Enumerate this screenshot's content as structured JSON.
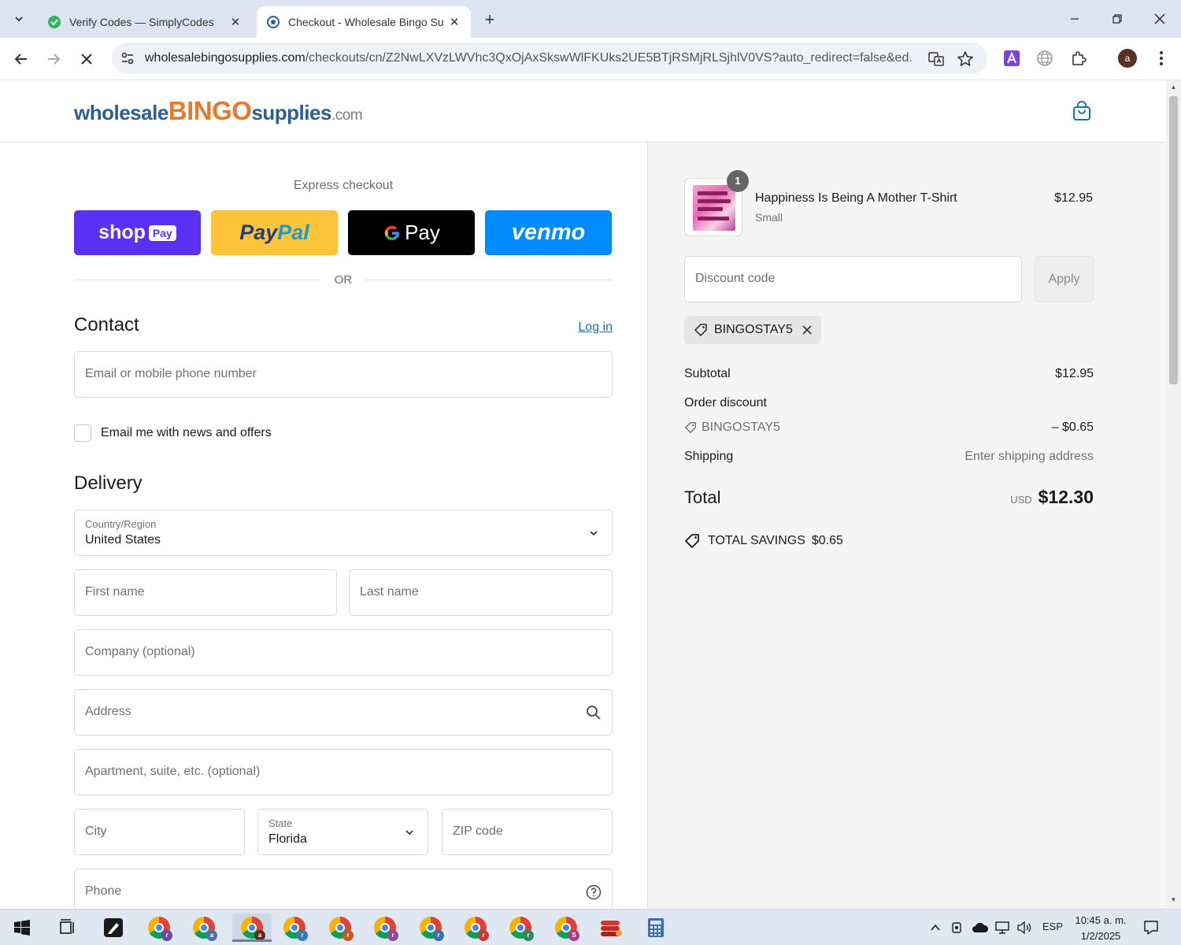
{
  "browser": {
    "tabs": [
      {
        "title": "Verify Codes — SimplyCodes",
        "active": false
      },
      {
        "title": "Checkout - Wholesale Bingo Su",
        "active": true
      }
    ],
    "url_host": "wholesalebingosupplies.com",
    "url_path": "/checkouts/cn/Z2NwLXVzLWVhc3QxOjAxSkswWlFKUks2UE5BTjRSMjRLSjhlV0VS?auto_redirect=false&ed..."
  },
  "store": {
    "logo_part1": "wholesale",
    "logo_part2": "BINGO",
    "logo_part3": "supplies",
    "logo_part4": ".com"
  },
  "express": {
    "label": "Express checkout",
    "shop_label": "shop",
    "shop_pay_tag": "Pay",
    "paypal_p1": "Pay",
    "paypal_p2": "Pal",
    "gpay_label": "Pay",
    "venmo_label": "venmo",
    "or_label": "OR"
  },
  "contact": {
    "title": "Contact",
    "login_label": "Log in",
    "email_placeholder": "Email or mobile phone number",
    "news_label": "Email me with news and offers"
  },
  "delivery": {
    "title": "Delivery",
    "country_label": "Country/Region",
    "country_value": "United States",
    "first_name_placeholder": "First name",
    "last_name_placeholder": "Last name",
    "company_placeholder": "Company (optional)",
    "address_placeholder": "Address",
    "apartment_placeholder": "Apartment, suite, etc. (optional)",
    "city_placeholder": "City",
    "state_label": "State",
    "state_value": "Florida",
    "zip_placeholder": "ZIP code",
    "phone_placeholder": "Phone"
  },
  "summary": {
    "product": {
      "name": "Happiness Is Being A Mother T-Shirt",
      "variant": "Small",
      "price": "$12.95",
      "quantity": "1"
    },
    "discount_placeholder": "Discount code",
    "apply_label": "Apply",
    "applied_code": "BINGOSTAY5",
    "subtotal_label": "Subtotal",
    "subtotal_value": "$12.95",
    "order_discount_label": "Order discount",
    "discount_code": "BINGOSTAY5",
    "discount_value": "– $0.65",
    "shipping_label": "Shipping",
    "shipping_value": "Enter shipping address",
    "total_label": "Total",
    "total_currency": "USD",
    "total_value": "$12.30",
    "savings_label": "TOTAL SAVINGS",
    "savings_value": "$0.65"
  },
  "taskbar": {
    "language": "ESP",
    "time": "10:45 a. m.",
    "date": "1/2/2025",
    "chrome_profiles": [
      "r",
      "a",
      "a",
      "r",
      "r",
      "r",
      "r",
      "r",
      "r",
      "S"
    ]
  },
  "colors": {
    "shop_pay": "#5a31f4",
    "paypal": "#ffc439",
    "venmo": "#008cff",
    "link": "#1773b0",
    "logo_blue": "#2a5e96",
    "logo_orange": "#e8792b"
  }
}
